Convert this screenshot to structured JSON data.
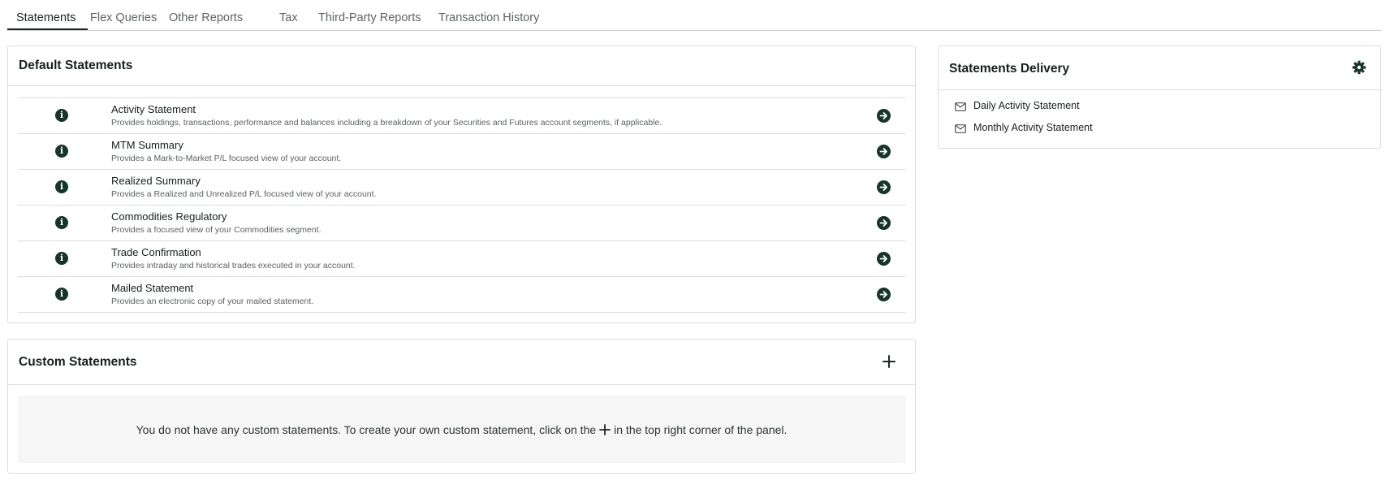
{
  "tabs": [
    {
      "label": "Statements",
      "active": true
    },
    {
      "label": "Flex Queries",
      "active": false
    },
    {
      "label": "Other Reports",
      "active": false
    },
    {
      "label": "Tax",
      "active": false
    },
    {
      "label": "Third-Party Reports",
      "active": false
    },
    {
      "label": "Transaction History",
      "active": false
    }
  ],
  "default_statements": {
    "title": "Default Statements",
    "items": [
      {
        "name": "Activity Statement",
        "description": "Provides holdings, transactions, performance and balances including a breakdown of your Securities and Futures account segments, if applicable.",
        "info_icon": "info-icon",
        "action_icon": "arrow-right-circle-icon"
      },
      {
        "name": "MTM Summary",
        "description": "Provides a Mark-to-Market P/L focused view of your account.",
        "info_icon": "info-icon",
        "action_icon": "arrow-right-circle-icon"
      },
      {
        "name": "Realized Summary",
        "description": "Provides a Realized and Unrealized P/L focused view of your account.",
        "info_icon": "info-icon",
        "action_icon": "arrow-right-circle-icon"
      },
      {
        "name": "Commodities Regulatory",
        "description": "Provides a focused view of your Commodities segment.",
        "info_icon": "info-icon",
        "action_icon": "arrow-right-circle-icon"
      },
      {
        "name": "Trade Confirmation",
        "description": "Provides intraday and historical trades executed in your account.",
        "info_icon": "info-icon",
        "action_icon": "arrow-right-circle-icon"
      },
      {
        "name": "Mailed Statement",
        "description": "Provides an electronic copy of your mailed statement.",
        "info_icon": "info-icon",
        "action_icon": "arrow-right-circle-icon"
      }
    ]
  },
  "custom_statements": {
    "title": "Custom Statements",
    "add_icon": "plus-icon",
    "empty_text_before": "You do not have any custom statements. To create your own custom statement, click on the",
    "empty_text_after": "in the top right corner of the panel."
  },
  "statements_delivery": {
    "title": "Statements Delivery",
    "settings_icon": "gear-icon",
    "items": [
      {
        "label": "Daily Activity Statement",
        "icon": "envelope-icon"
      },
      {
        "label": "Monthly Activity Statement",
        "icon": "envelope-icon"
      }
    ]
  },
  "colors": {
    "icon_dark_green": "#17352a",
    "border": "#dadddb",
    "empty_bg": "#f5f6f5"
  }
}
